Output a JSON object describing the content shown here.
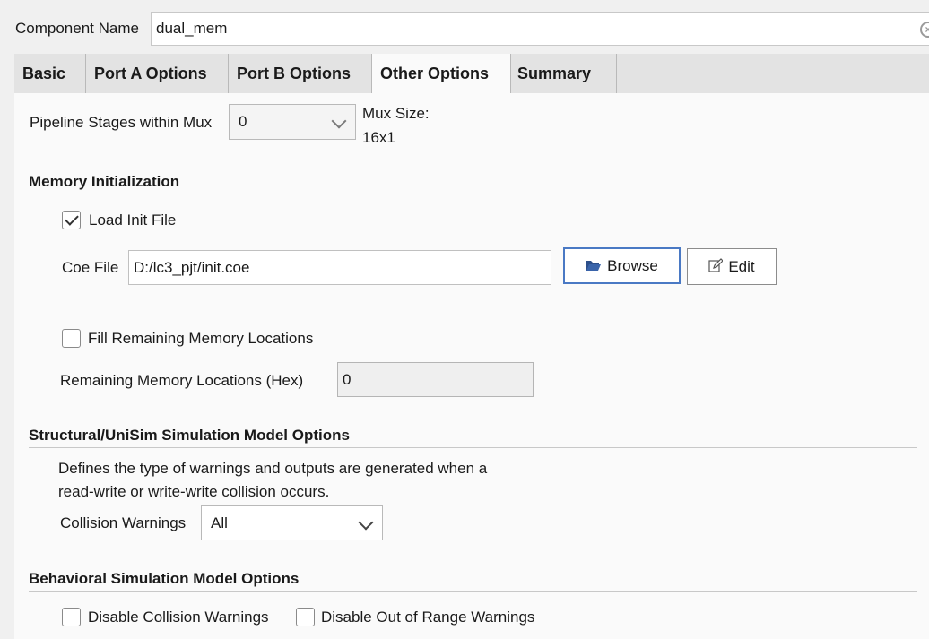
{
  "component": {
    "label": "Component Name",
    "value": "dual_mem"
  },
  "tabs": [
    {
      "label": "Basic",
      "active": false
    },
    {
      "label": "Port A Options",
      "active": false
    },
    {
      "label": "Port B Options",
      "active": false
    },
    {
      "label": "Other Options",
      "active": true
    },
    {
      "label": "Summary",
      "active": false
    }
  ],
  "pipeline": {
    "label": "Pipeline Stages within Mux",
    "value": "0",
    "mux_size_label": "Mux Size:",
    "mux_size_value": "16x1"
  },
  "memory_init": {
    "title": "Memory Initialization",
    "load_init_label": "Load Init File",
    "load_init_checked": true,
    "coe_label": "Coe File",
    "coe_value": "D:/lc3_pjt/init.coe",
    "browse_label": "Browse",
    "edit_label": "Edit",
    "fill_label": "Fill Remaining Memory Locations",
    "fill_checked": false,
    "remaining_label": "Remaining Memory Locations (Hex)",
    "remaining_value": "0"
  },
  "structural": {
    "title": "Structural/UniSim Simulation Model Options",
    "desc_line1": "Defines the type of warnings and outputs are generated when a",
    "desc_line2": "read-write or write-write collision occurs.",
    "collision_label": "Collision Warnings",
    "collision_value": "All"
  },
  "behavioral": {
    "title": "Behavioral Simulation Model Options",
    "disable_collision_label": "Disable Collision Warnings",
    "disable_collision_checked": false,
    "disable_range_label": "Disable Out of Range Warnings",
    "disable_range_checked": false
  },
  "colors": {
    "focus_border": "#4a79c4",
    "panel_bg": "#fafafa",
    "window_bg": "#f0f0f0"
  }
}
